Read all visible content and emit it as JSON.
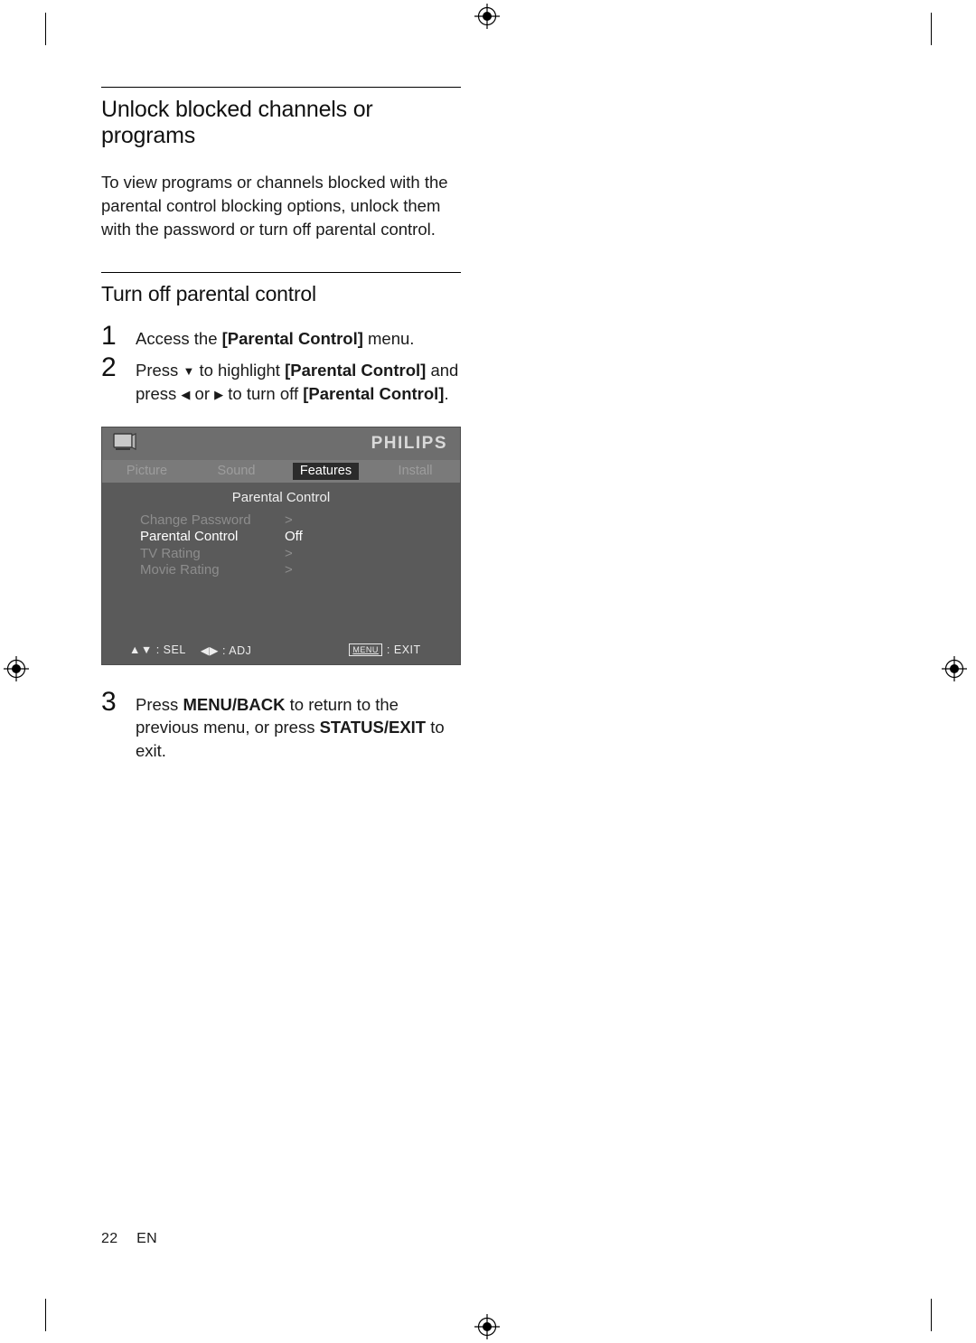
{
  "document": {
    "heading1": "Unlock blocked channels or programs",
    "paragraph1": "To view programs or channels blocked with the parental control blocking options, unlock them with the password or turn off parental control.",
    "heading2": "Turn off parental control",
    "steps": [
      {
        "number": "1",
        "parts": [
          {
            "text": "Access the ",
            "style": "normal"
          },
          {
            "text": "[Parental Control]",
            "style": "bold"
          },
          {
            "text": " menu.",
            "style": "normal"
          }
        ]
      },
      {
        "number": "2",
        "parts": [
          {
            "text": "Press ",
            "style": "normal"
          },
          {
            "text": "▼",
            "style": "arrow"
          },
          {
            "text": " to highlight ",
            "style": "normal"
          },
          {
            "text": "[Parental Control]",
            "style": "bold"
          },
          {
            "text": " and press ",
            "style": "normal"
          },
          {
            "text": "◀",
            "style": "arrow"
          },
          {
            "text": " or ",
            "style": "normal"
          },
          {
            "text": "▶",
            "style": "arrow"
          },
          {
            "text": " to turn off ",
            "style": "normal"
          },
          {
            "text": "[Parental Control]",
            "style": "bold"
          },
          {
            "text": ".",
            "style": "normal"
          }
        ]
      },
      {
        "number": "3",
        "parts": [
          {
            "text": "Press ",
            "style": "normal"
          },
          {
            "text": "MENU/BACK",
            "style": "bold"
          },
          {
            "text": " to return to the previous menu, or press ",
            "style": "normal"
          },
          {
            "text": "STATUS/EXIT",
            "style": "bold"
          },
          {
            "text": " to exit.",
            "style": "normal"
          }
        ]
      }
    ],
    "footer": {
      "page_number": "22",
      "language": "EN"
    }
  },
  "osd": {
    "brand": "PHILIPS",
    "tv_icon": "tv-icon",
    "tabs": [
      {
        "label": "Picture",
        "active": false
      },
      {
        "label": "Sound",
        "active": false
      },
      {
        "label": "Features",
        "active": true
      },
      {
        "label": "Install",
        "active": false
      }
    ],
    "subtitle": "Parental Control",
    "rows": [
      {
        "label": "Change Password",
        "value": ">",
        "selected": false
      },
      {
        "label": "Parental Control",
        "value": "Off",
        "selected": true
      },
      {
        "label": "TV Rating",
        "value": ">",
        "selected": false
      },
      {
        "label": "Movie Rating",
        "value": ">",
        "selected": false
      }
    ],
    "footer": {
      "select_keys": "▲▼",
      "select_label": ": SEL",
      "adjust_keys": "◀▶",
      "adjust_label": ": ADJ",
      "menu_key": "MENU",
      "exit_label": ": EXIT"
    }
  }
}
